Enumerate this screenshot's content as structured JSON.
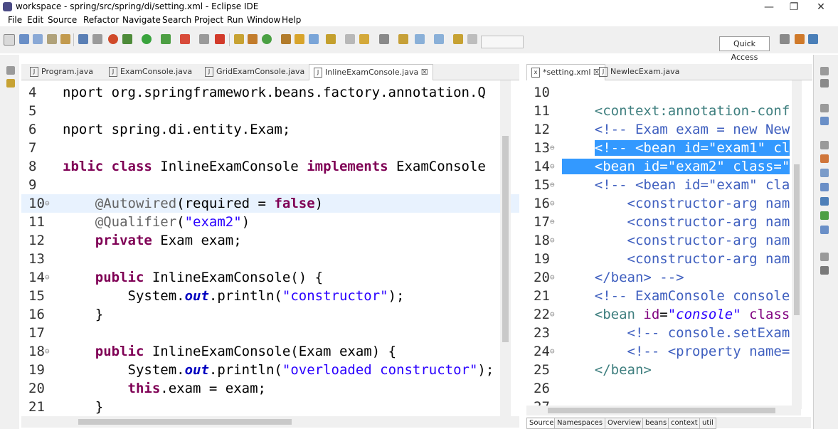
{
  "window": {
    "title": "workspace - spring/src/spring/di/setting.xml - Eclipse IDE",
    "minimize_glyph": "—",
    "restore_glyph": "❐",
    "close_glyph": "✕"
  },
  "menu": [
    "File",
    "Edit",
    "Source",
    "Refactor",
    "Navigate",
    "Search",
    "Project",
    "Run",
    "Window",
    "Help"
  ],
  "toolbar": {
    "quick_access": "Quick Access"
  },
  "left_editor": {
    "tabs": [
      {
        "label": "Program.java"
      },
      {
        "label": "ExamConsole.java"
      },
      {
        "label": "GridExamConsole.java"
      },
      {
        "label": "InlineExamConsole.java",
        "active": true,
        "close": "☒"
      }
    ],
    "lines": [
      {
        "n": "4",
        "parts": [
          [
            "",
            "nport org.springframework.beans.factory.annotation.Q"
          ]
        ]
      },
      {
        "n": "5",
        "parts": []
      },
      {
        "n": "6",
        "parts": [
          [
            "",
            "nport spring.di.entity.Exam;"
          ]
        ]
      },
      {
        "n": "7",
        "parts": []
      },
      {
        "n": "8",
        "parts": [
          [
            "kw",
            "ıblic class "
          ],
          [
            "",
            "InlineExamConsole "
          ],
          [
            "kw",
            "implements "
          ],
          [
            "",
            "ExamConsole"
          ]
        ]
      },
      {
        "n": "9",
        "parts": []
      },
      {
        "n": "10",
        "fold": "⊖",
        "current": true,
        "parts": [
          [
            "",
            "    "
          ],
          [
            "ann",
            "@Autowired"
          ],
          [
            "",
            "(required = "
          ],
          [
            "kw",
            "false"
          ],
          [
            "",
            ")"
          ]
        ]
      },
      {
        "n": "11",
        "parts": [
          [
            "",
            "    "
          ],
          [
            "ann",
            "@Qualifier"
          ],
          [
            "",
            "("
          ],
          [
            "str",
            "\"exam2\""
          ],
          [
            "",
            ")"
          ]
        ]
      },
      {
        "n": "12",
        "parts": [
          [
            "",
            "    "
          ],
          [
            "kw",
            "private "
          ],
          [
            "",
            "Exam exam;"
          ]
        ]
      },
      {
        "n": "13",
        "parts": []
      },
      {
        "n": "14",
        "fold": "⊖",
        "parts": [
          [
            "",
            "    "
          ],
          [
            "kw",
            "public "
          ],
          [
            "",
            "InlineExamConsole() {"
          ]
        ]
      },
      {
        "n": "15",
        "parts": [
          [
            "",
            "        System."
          ],
          [
            "fld",
            "out"
          ],
          [
            "",
            ".println("
          ],
          [
            "str",
            "\"constructor\""
          ],
          [
            "",
            ");"
          ]
        ]
      },
      {
        "n": "16",
        "parts": [
          [
            "",
            "    }"
          ]
        ]
      },
      {
        "n": "17",
        "parts": []
      },
      {
        "n": "18",
        "fold": "⊖",
        "parts": [
          [
            "",
            "    "
          ],
          [
            "kw",
            "public "
          ],
          [
            "",
            "InlineExamConsole(Exam exam) {"
          ]
        ]
      },
      {
        "n": "19",
        "parts": [
          [
            "",
            "        System."
          ],
          [
            "fld",
            "out"
          ],
          [
            "",
            ".println("
          ],
          [
            "str",
            "\"overloaded constructor\""
          ],
          [
            "",
            ");"
          ]
        ]
      },
      {
        "n": "20",
        "parts": [
          [
            "",
            "        "
          ],
          [
            "kw",
            "this"
          ],
          [
            "",
            ".exam = exam;"
          ]
        ]
      },
      {
        "n": "21",
        "parts": [
          [
            "",
            "    }"
          ]
        ]
      }
    ]
  },
  "right_editor": {
    "tabs": [
      {
        "label": "*setting.xml",
        "active": true,
        "close": "☒"
      },
      {
        "label": "NewlecExam.java"
      }
    ],
    "lines": [
      {
        "n": "10",
        "parts": []
      },
      {
        "n": "11",
        "parts": [
          [
            "tag",
            "    <context:annotation-conf"
          ]
        ]
      },
      {
        "n": "12",
        "parts": [
          [
            "cm",
            "    <!-- Exam exam = new New"
          ]
        ]
      },
      {
        "n": "13",
        "fold": "⊖",
        "parts": [
          [
            "",
            "    "
          ],
          [
            "sel",
            "<!-- <bean id=\"exam1\" cl"
          ]
        ]
      },
      {
        "n": "14",
        "fold": "⊖",
        "selected": true,
        "parts": [
          [
            "sel",
            "    <bean id=\"exam2\" class=\""
          ]
        ]
      },
      {
        "n": "15",
        "fold": "⊖",
        "parts": [
          [
            "cm",
            "    <!-- <bean id=\"exam\" cla"
          ]
        ]
      },
      {
        "n": "16",
        "fold": "⊖",
        "parts": [
          [
            "cm",
            "        <constructor-arg nam"
          ]
        ]
      },
      {
        "n": "17",
        "fold": "⊖",
        "parts": [
          [
            "cm",
            "        <constructor-arg nam"
          ]
        ]
      },
      {
        "n": "18",
        "fold": "⊖",
        "parts": [
          [
            "cm",
            "        <constructor-arg nam"
          ]
        ]
      },
      {
        "n": "19",
        "parts": [
          [
            "cm",
            "        <constructor-arg nam"
          ]
        ]
      },
      {
        "n": "20",
        "fold": "⊖",
        "parts": [
          [
            "cm",
            "    </bean> -->"
          ]
        ]
      },
      {
        "n": "21",
        "parts": [
          [
            "cm",
            "    <!-- ExamConsole console"
          ]
        ]
      },
      {
        "n": "22",
        "fold": "⊖",
        "parts": [
          [
            "tag",
            "    <bean "
          ],
          [
            "attr",
            "id"
          ],
          [
            "",
            "="
          ],
          [
            "val",
            "\"console\""
          ],
          [
            "",
            " "
          ],
          [
            "attr",
            "class"
          ]
        ]
      },
      {
        "n": "23",
        "parts": [
          [
            "cm",
            "        <!-- console.setExam"
          ]
        ]
      },
      {
        "n": "24",
        "fold": "⊖",
        "parts": [
          [
            "cm",
            "        <!-- <property name="
          ]
        ]
      },
      {
        "n": "25",
        "parts": [
          [
            "tag",
            "    </bean>"
          ]
        ]
      },
      {
        "n": "26",
        "parts": []
      },
      {
        "n": "27",
        "parts": []
      }
    ],
    "bottom_tabs": [
      "Source",
      "Namespaces",
      "Overview",
      "beans",
      "context",
      "util"
    ]
  },
  "colors": {
    "selection": "#3399ff",
    "keyword": "#7f0055",
    "string": "#2a00ff",
    "comment": "#3f5fbf"
  }
}
